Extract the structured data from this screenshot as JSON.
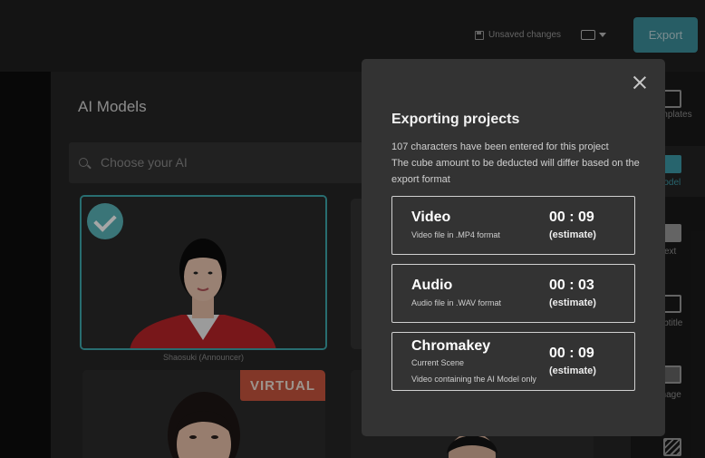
{
  "topbar": {
    "unsaved_label": "Unsaved changes",
    "export_label": "Export"
  },
  "panel": {
    "title": "AI Models",
    "search_placeholder": "Choose your AI",
    "cards": [
      {
        "caption": "Shaosuki (Announcer)",
        "selected": true
      },
      {
        "badge": "VIRTUAL"
      }
    ]
  },
  "sidebar": {
    "items": [
      {
        "label": "Templates",
        "icon": "templates-icon"
      },
      {
        "label": "Model",
        "icon": "model-icon",
        "active": true
      },
      {
        "label": "Text",
        "icon": "text-icon"
      },
      {
        "label": "Subtitle",
        "icon": "subtitle-icon"
      },
      {
        "label": "Image",
        "icon": "image-icon"
      },
      {
        "label": "",
        "icon": "background-icon"
      }
    ]
  },
  "modal": {
    "title": "Exporting projects",
    "desc_line1": "107 characters have been entered for this project",
    "desc_line2": "The cube amount to be deducted will differ based on the export format",
    "options": [
      {
        "name": "Video",
        "sub": "Video file in .MP4 format",
        "time": "00 : 09",
        "estimate": "(estimate)"
      },
      {
        "name": "Audio",
        "sub": "Audio file in .WAV format",
        "time": "00 : 03",
        "estimate": "(estimate)"
      },
      {
        "name": "Chromakey",
        "sub": "Current Scene",
        "sub2": "Video containing the AI Model only",
        "time": "00 : 09",
        "estimate": "(estimate)"
      }
    ]
  },
  "colors": {
    "accent": "#3d8f9c",
    "badge": "#c8553e",
    "selected_border": "#3ea8ad"
  }
}
